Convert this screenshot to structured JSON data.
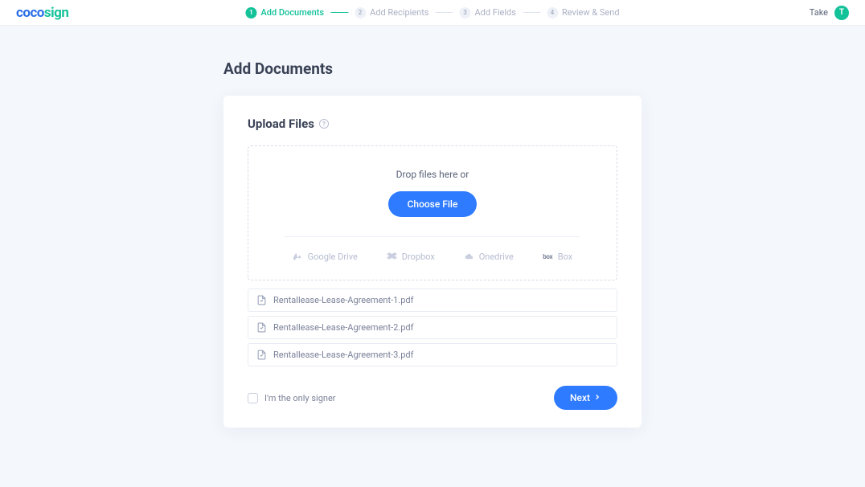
{
  "brand": {
    "part1": "coco",
    "part2": "sign"
  },
  "stepper": {
    "steps": [
      {
        "num": "1",
        "label": "Add Documents",
        "active": true
      },
      {
        "num": "2",
        "label": "Add Recipients",
        "active": false
      },
      {
        "num": "3",
        "label": "Add Fields",
        "active": false
      },
      {
        "num": "4",
        "label": "Review & Send",
        "active": false
      }
    ]
  },
  "user": {
    "name": "Take",
    "initial": "T"
  },
  "page": {
    "title": "Add Documents"
  },
  "upload": {
    "section_title": "Upload Files",
    "help_mark": "?",
    "drop_text": "Drop files here or",
    "choose_label": "Choose File",
    "providers": [
      {
        "label": "Google Drive",
        "icon": "google-drive-icon"
      },
      {
        "label": "Dropbox",
        "icon": "dropbox-icon"
      },
      {
        "label": "Onedrive",
        "icon": "onedrive-icon"
      },
      {
        "label": "Box",
        "icon": "box-icon"
      }
    ],
    "files": [
      {
        "name": "Rentallease-Lease-Agreement-1.pdf"
      },
      {
        "name": "Rentallease-Lease-Agreement-2.pdf"
      },
      {
        "name": "Rentallease-Lease-Agreement-3.pdf"
      }
    ]
  },
  "footer": {
    "only_signer_label": "I'm the only signer",
    "only_signer_checked": false,
    "next_label": "Next"
  }
}
